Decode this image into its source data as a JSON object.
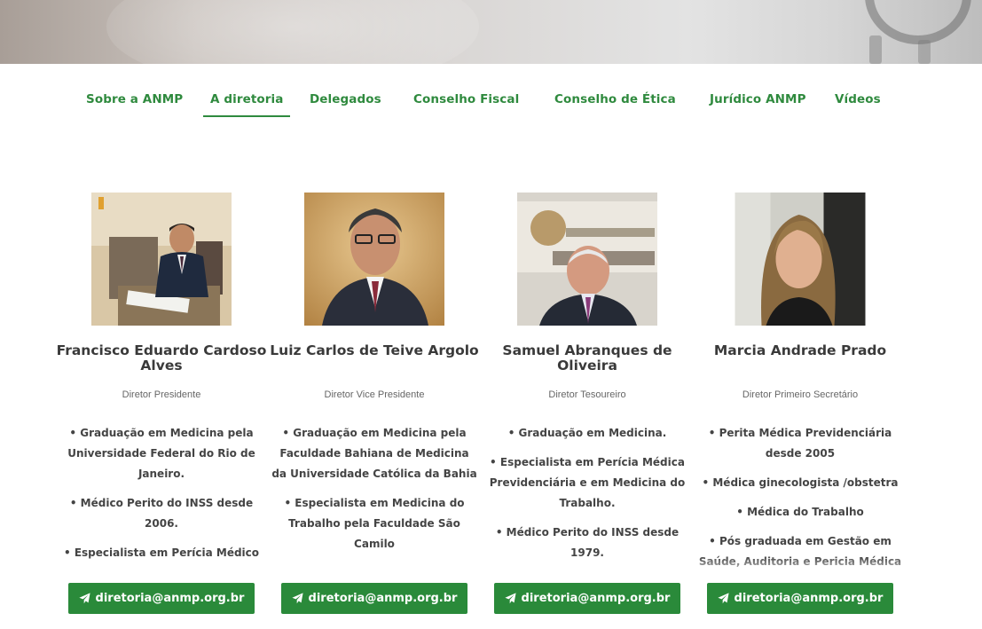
{
  "nav": {
    "tabs": [
      {
        "label": "Sobre a ANMP"
      },
      {
        "label": "A diretoria"
      },
      {
        "label": "Delegados"
      },
      {
        "label": "Conselho Fiscal"
      },
      {
        "label": "Conselho de Ética"
      },
      {
        "label": "Jurídico ANMP"
      },
      {
        "label": "Vídeos"
      }
    ],
    "active_tab": "A diretoria"
  },
  "members": [
    {
      "name": "Francisco Eduardo Cardoso Alves",
      "role": "Diretor Presidente",
      "bio": [
        "• Graduação em Medicina pela Universidade Federal do Rio de Janeiro.",
        "• Médico Perito do INSS desde 2006.",
        "• Especialista em Perícia Médico Judicial pela Escola Paulista de"
      ],
      "email": "diretoria@anmp.org.br"
    },
    {
      "name": "Luiz Carlos de Teive Argolo",
      "role": "Diretor Vice Presidente",
      "bio": [
        "• Graduação em Medicina pela Faculdade Bahiana de Medicina da Universidade Católica da Bahia",
        "• Especialista em Medicina do Trabalho pela Faculdade São Camilo"
      ],
      "email": "diretoria@anmp.org.br"
    },
    {
      "name": "Samuel Abranques de Oliveira",
      "role": "Diretor Tesoureiro",
      "bio": [
        "• Graduação em Medicina.",
        "• Especialista em Perícia Médica Previdenciária e em Medicina do Trabalho.",
        "• Médico Perito do INSS desde 1979."
      ],
      "email": "diretoria@anmp.org.br"
    },
    {
      "name": "Marcia Andrade Prado",
      "role": "Diretor Primeiro Secretário",
      "bio": [
        "• Perita Médica Previdenciária desde 2005",
        "• Médica ginecologista /obstetra",
        "• Médica do Trabalho",
        "• Pós graduada em Gestão em Saúde, Auditoria e Pericia Médica"
      ],
      "email": "diretoria@anmp.org.br"
    }
  ],
  "colors": {
    "accent": "#2f8a3e",
    "button": "#2a8a3a"
  },
  "icons": {
    "email_button": "paper-plane-icon"
  }
}
